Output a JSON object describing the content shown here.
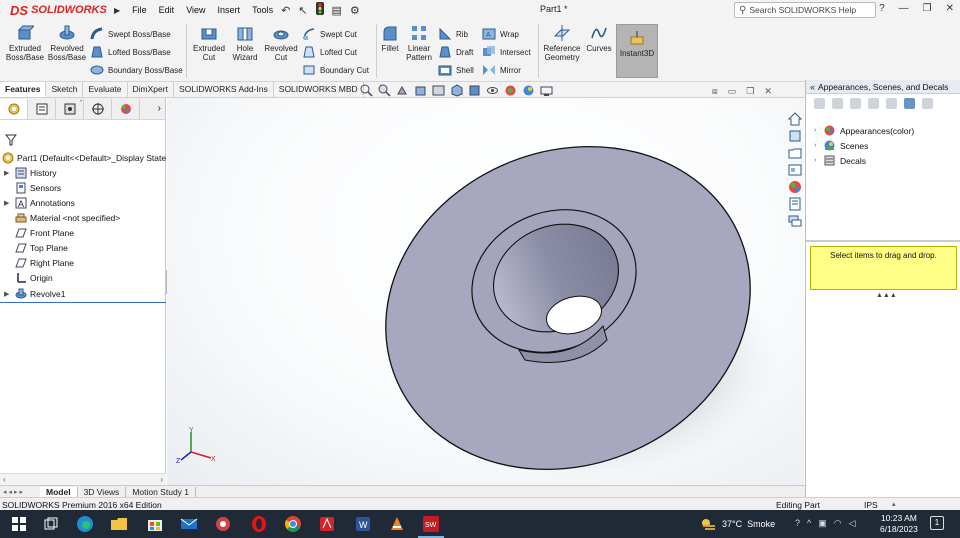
{
  "app": {
    "logo_ds": "DS",
    "logo_text": "SOLIDWORKS",
    "document_title": "Part1 *",
    "menu": [
      "File",
      "Edit",
      "View",
      "Insert",
      "Tools"
    ]
  },
  "help_search": {
    "placeholder": "Search SOLIDWORKS Help"
  },
  "command_manager": {
    "big_buttons": [
      {
        "label": "Extruded Boss/Base",
        "icon": "extrude-boss-icon"
      },
      {
        "label": "Revolved Boss/Base",
        "icon": "revolve-boss-icon"
      },
      {
        "label": "Extruded Cut",
        "icon": "extrude-cut-icon"
      },
      {
        "label": "Hole Wizard",
        "icon": "hole-wizard-icon"
      },
      {
        "label": "Revolved Cut",
        "icon": "revolve-cut-icon"
      },
      {
        "label": "Fillet",
        "icon": "fillet-icon"
      },
      {
        "label": "Linear Pattern",
        "icon": "linear-pattern-icon"
      },
      {
        "label": "Reference Geometry",
        "icon": "reference-geometry-icon"
      },
      {
        "label": "Curves",
        "icon": "curves-icon"
      },
      {
        "label": "Instant3D",
        "icon": "instant3d-icon"
      }
    ],
    "small_buttons": [
      {
        "label": "Swept Boss/Base",
        "icon": "swept-boss-icon"
      },
      {
        "label": "Lofted Boss/Base",
        "icon": "lofted-boss-icon"
      },
      {
        "label": "Boundary Boss/Base",
        "icon": "boundary-boss-icon"
      },
      {
        "label": "Swept Cut",
        "icon": "swept-cut-icon"
      },
      {
        "label": "Lofted Cut",
        "icon": "lofted-cut-icon"
      },
      {
        "label": "Boundary Cut",
        "icon": "boundary-cut-icon"
      },
      {
        "label": "Rib",
        "icon": "rib-icon"
      },
      {
        "label": "Draft",
        "icon": "draft-icon"
      },
      {
        "label": "Shell",
        "icon": "shell-icon"
      },
      {
        "label": "Wrap",
        "icon": "wrap-icon"
      },
      {
        "label": "Intersect",
        "icon": "intersect-icon"
      },
      {
        "label": "Mirror",
        "icon": "mirror-icon"
      }
    ],
    "tabs": [
      "Features",
      "Sketch",
      "Evaluate",
      "DimXpert",
      "SOLIDWORKS Add-Ins",
      "SOLIDWORKS MBD"
    ],
    "active_tab": "Features"
  },
  "feature_tree": {
    "root": "Part1  (Default<<Default>_Display State",
    "items": [
      {
        "label": "History",
        "icon": "history-icon",
        "expandable": true
      },
      {
        "label": "Sensors",
        "icon": "sensors-icon",
        "expandable": false
      },
      {
        "label": "Annotations",
        "icon": "annotations-icon",
        "expandable": true
      },
      {
        "label": "Material <not specified>",
        "icon": "material-icon",
        "expandable": false
      },
      {
        "label": "Front Plane",
        "icon": "plane-icon",
        "expandable": false
      },
      {
        "label": "Top Plane",
        "icon": "plane-icon",
        "expandable": false
      },
      {
        "label": "Right Plane",
        "icon": "plane-icon",
        "expandable": false
      },
      {
        "label": "Origin",
        "icon": "origin-icon",
        "expandable": false
      },
      {
        "label": "Revolve1",
        "icon": "revolve-feature-icon",
        "expandable": true
      }
    ]
  },
  "task_pane": {
    "title": "Appearances, Scenes, and Decals",
    "items": [
      {
        "label": "Appearances(color)",
        "icon": "appearances-icon"
      },
      {
        "label": "Scenes",
        "icon": "scenes-icon"
      },
      {
        "label": "Decals",
        "icon": "decals-icon"
      }
    ],
    "drag_hint": "Select items to drag and drop."
  },
  "model_tabs": [
    "Model",
    "3D Views",
    "Motion Study 1"
  ],
  "active_model_tab": "Model",
  "status_bar": {
    "product": "SOLIDWORKS Premium 2016 x64 Edition",
    "mode": "Editing Part",
    "units": "IPS"
  },
  "taskbar": {
    "weather_temp": "37°C",
    "weather_text": "Smoke",
    "time": "10:23 AM",
    "date": "6/18/2023",
    "notification_count": "1"
  },
  "colors": {
    "part_face": "#a7a8bf",
    "part_bore": "#8f91a8",
    "brand_red": "#dd2222",
    "hint_yellow": "#ffff88",
    "taskbar": "#1f2a36"
  }
}
